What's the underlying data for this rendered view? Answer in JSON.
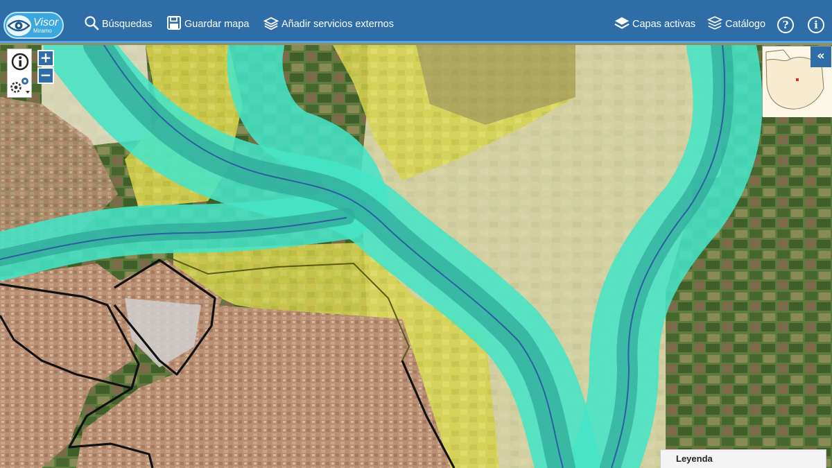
{
  "app": {
    "logo_main": "Visor",
    "logo_sub": "Miramo"
  },
  "toolbar": {
    "search_label": "Búsquedas",
    "save_map_label": "Guardar mapa",
    "add_services_label": "Añadir servicios externos",
    "active_layers_label": "Capas activas",
    "catalog_label": "Catálogo",
    "help_label": "?",
    "info_label": "i"
  },
  "map_tools": {
    "zoom_in": "+",
    "zoom_out": "−",
    "collapse_overview": "«"
  },
  "legend": {
    "title": "Leyenda"
  },
  "colors": {
    "topbar": "#2f6da8",
    "flood_zone_cyan": "#38e0c0",
    "flood_zone_yellow": "#e6e15a",
    "municipal_boundary": "#111111"
  },
  "icons": {
    "search": "search-icon",
    "save": "save-icon",
    "add_services": "layers-add-icon",
    "active_layers": "layers-icon",
    "catalog": "catalog-stack-icon",
    "help": "help-icon",
    "info": "info-icon"
  }
}
